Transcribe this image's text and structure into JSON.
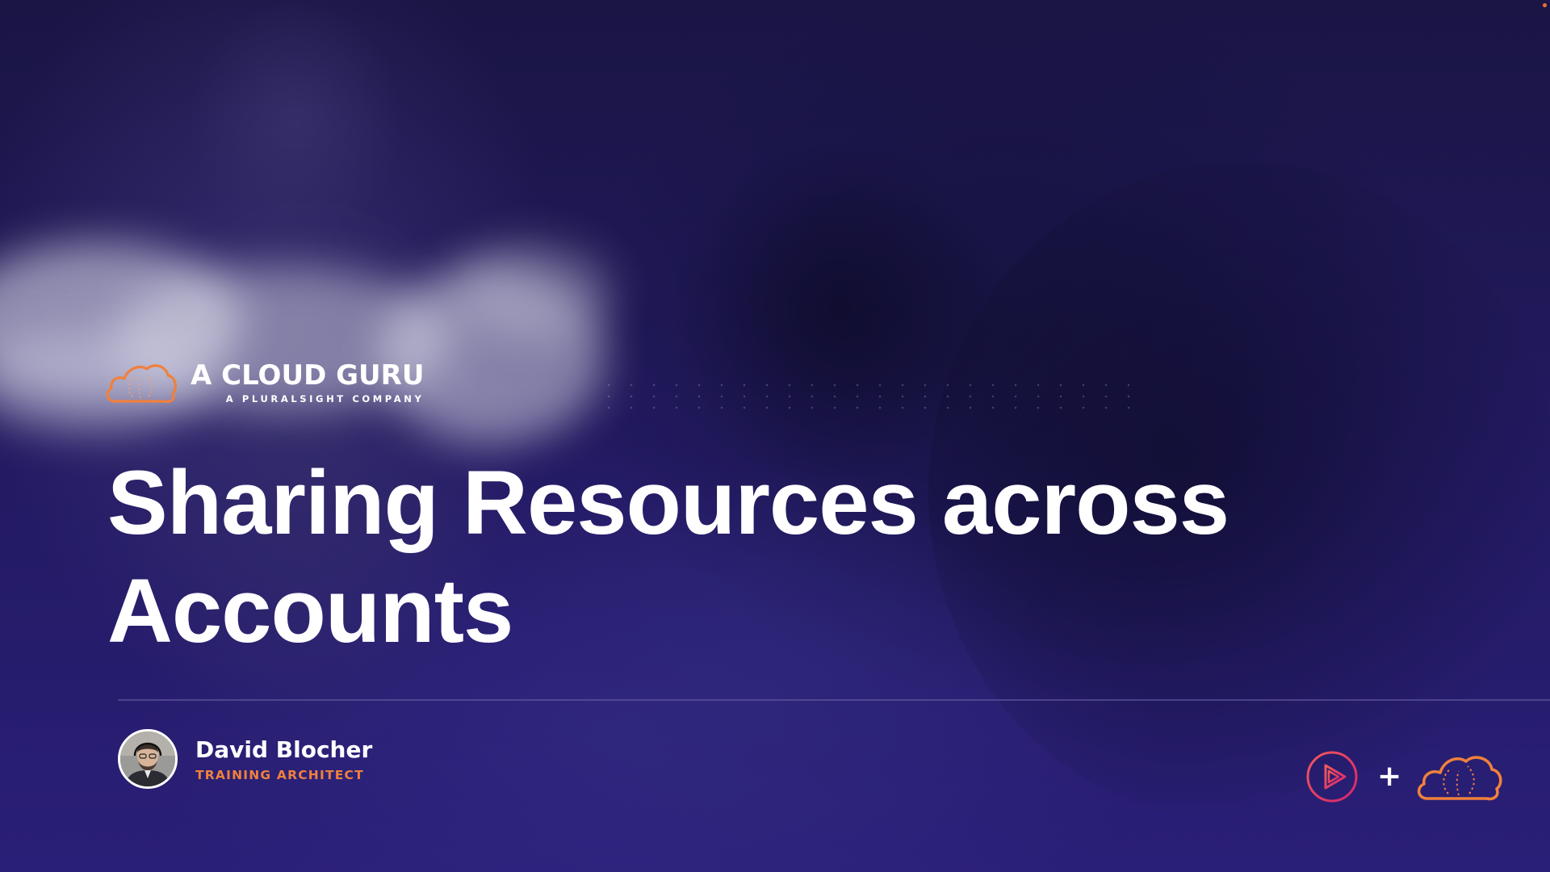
{
  "brand": {
    "name": "A CLOUD GURU",
    "tagline": "A PLURALSIGHT COMPANY",
    "logo_icon": "cloud-guru-logo-icon",
    "accent_color": "#f0803c"
  },
  "slide": {
    "title": "Sharing Resources across Accounts"
  },
  "presenter": {
    "name": "David Blocher",
    "role": "TRAINING ARCHITECT",
    "avatar_icon": "presenter-avatar"
  },
  "partners": {
    "left_logo": "pluralsight-play-icon",
    "plus_symbol": "+",
    "right_logo": "cloud-guru-cloud-icon",
    "pluralsight_color": "#e5376e"
  }
}
